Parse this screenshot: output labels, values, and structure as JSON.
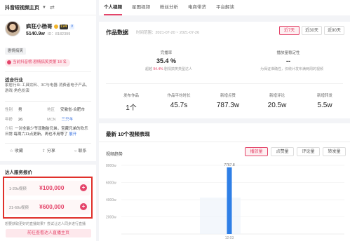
{
  "app": {
    "title": "抖音短视频主页"
  },
  "profile": {
    "name": "疯狂小杨哥",
    "level_badge": "Lv4",
    "verified_badge": "V",
    "fans": "5140.9w",
    "uid": "ID：8182399",
    "tag": "剧情搞笑",
    "rank_text": "当前抖音榜·剧情搞笑类第 18 名"
  },
  "industry": {
    "title": "适合行业",
    "text": "家居行业·工具饮料、3C与电器·消费者电子产品、游戏·角色扮演"
  },
  "info": {
    "gender_label": "性别",
    "gender": "男",
    "region_label": "地区",
    "region": "安徽省·合肥市",
    "age_label": "年龄",
    "age": "26",
    "mcn_label": "MCN",
    "mcn": "三只羊",
    "intro_label": "介绍",
    "intro_text": "一对全能少爷双胞胎兄弟，宝藏兄弟的欢乐日常 每周六11点更新，再也不用等了",
    "intro_more": "展开"
  },
  "actions": {
    "fav": "收藏",
    "share": "分享",
    "contact": "联系"
  },
  "services": {
    "title": "达人服务报价",
    "items": [
      {
        "label": "1-20s视频",
        "price": "¥100,000"
      },
      {
        "label": "21-60s视频",
        "price": "¥600,000"
      }
    ],
    "note": "想要获取更好的直播效果？尝试让达人同步进行直播",
    "button": "前往查看达人直播主页"
  },
  "tabs": [
    "个人视频",
    "星图视频",
    "粉丝分析",
    "电商带货",
    "平台解读"
  ],
  "overview": {
    "title": "作品数据",
    "date_range": "时间范围：2021-07-20 ~ 2021-07-26",
    "ranges": [
      "近7天",
      "近30天",
      "近90天"
    ],
    "completion_label": "完播率",
    "completion_value": "35.4 %",
    "completion_desc_pre": "超越 ",
    "completion_desc_pct": "94.4%",
    "completion_desc_post": " 剧情搞笑类型达人",
    "stability_label": "播放量稳定性",
    "stability_value": "--",
    "stability_desc": "为保证准确性，仅统计发布满两周的视频",
    "stats": [
      {
        "label": "发布作品",
        "value": "1个"
      },
      {
        "label": "作品平均时长",
        "value": "45.7s"
      },
      {
        "label": "新增点赞",
        "value": "787.3w"
      },
      {
        "label": "新增评论",
        "value": "20.5w"
      },
      {
        "label": "新增转发",
        "value": "5.5w"
      }
    ]
  },
  "recent": {
    "title": "最新 10个视频表现",
    "trend_label": "视频趋势",
    "metric_tabs": [
      "播放量",
      "点赞量",
      "评论量",
      "转发量"
    ]
  },
  "chart_data": {
    "type": "bar",
    "categories": [
      "12:03"
    ],
    "values": [
      7767.8
    ],
    "ylim": [
      0,
      8000
    ],
    "yticks": [
      "8000w",
      "6000w",
      "4000w",
      "2000w"
    ],
    "bar_label": "7767.8",
    "color": "#2f7fe6"
  },
  "colors": {
    "accent": "#e4456a",
    "bar": "#2f7fe6",
    "highlight_box": "#e0302a"
  }
}
